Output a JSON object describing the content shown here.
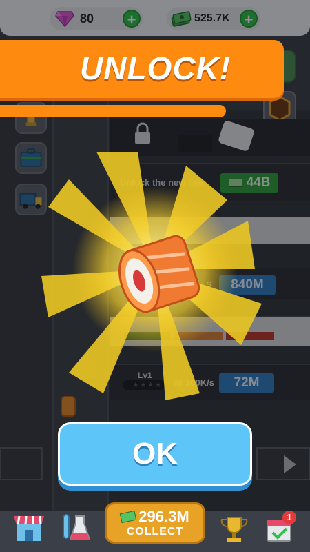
{
  "currency": {
    "gems": "80",
    "cash": "525.7K"
  },
  "banner": {
    "title": "UNLOCK!"
  },
  "lines": {
    "unlock_text": "Unlock the new line",
    "unlock_price": "44B",
    "line2_price": "840M",
    "line1_level": "Lv1",
    "line1_rate": "300K/s",
    "line1_price": "72M",
    "line2_rate_partial": "s"
  },
  "ok_button": {
    "label": "OK"
  },
  "bottom_bar": {
    "collect_amount": "296.3M",
    "collect_label": "COLLECT",
    "notification_count": "1"
  },
  "colors": {
    "banner_orange": "#ff8a10",
    "ok_blue": "#5ec5f8",
    "collect_gold": "#e8a326",
    "plus_green": "#2fc24a",
    "gem_pink": "#e05ad8"
  },
  "icons": [
    "gem-icon",
    "cash-icon",
    "plus-icon",
    "lock-icon",
    "shop-icon",
    "lab-icon",
    "trophy-icon",
    "calendar-check-icon",
    "sushi-roll-icon",
    "briefcase-icon",
    "delivery-truck-icon",
    "chef-hat-icon",
    "hexagon-badge-icon",
    "star-icon",
    "play-arrow-icon"
  ]
}
